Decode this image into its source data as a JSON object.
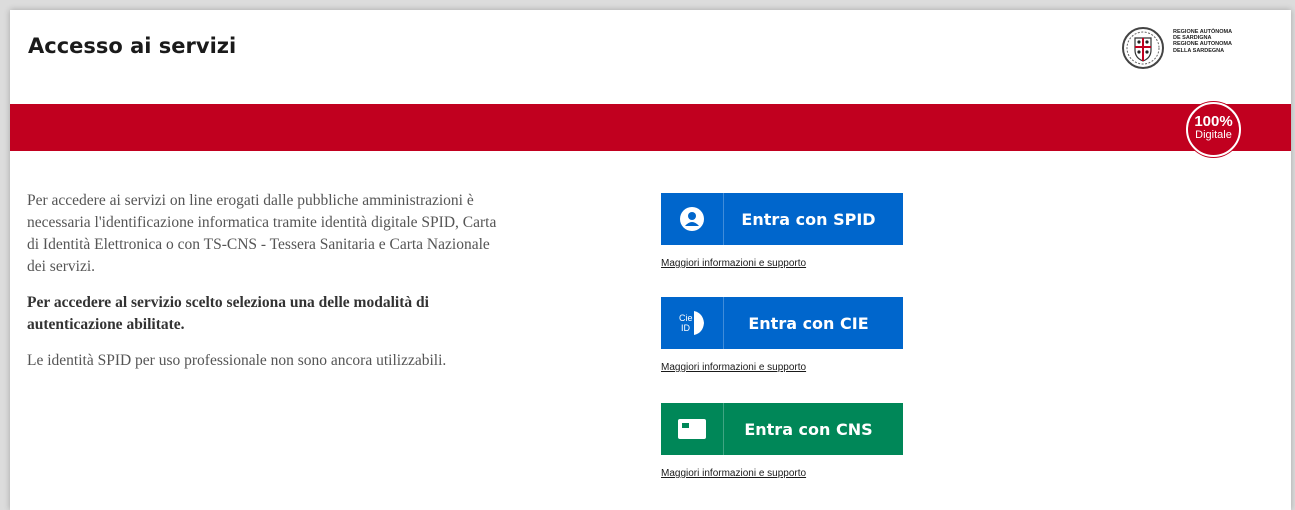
{
  "header": {
    "title": "Accesso ai servizi",
    "region_lines": [
      "REGIONE AUTÒNOMA",
      "DE SARDIGNA",
      "REGIONE AUTONOMA",
      "DELLA SARDEGNA"
    ]
  },
  "badge": {
    "percent": "100%",
    "label": "Digitale"
  },
  "intro": {
    "paragraph1": "Per accedere ai servizi on line erogati dalle pubbliche amministrazioni è necessaria l'identificazione informatica tramite identità digitale SPID, Carta di Identità Elettronica o con TS-CNS - Tessera Sanitaria e Carta Nazionale dei servizi.",
    "paragraph2": "Per accedere al servizio scelto seleziona una delle modalità di autenticazione abilitate.",
    "paragraph3": "Le identità SPID per uso professionale non sono ancora utilizzabili."
  },
  "login": {
    "spid_label": "Entra con SPID",
    "cie_label": "Entra con CIE",
    "cns_label": "Entra con CNS",
    "cie_icon_text_top": "Cie",
    "cie_icon_text_bottom": "ID",
    "more_info": "Maggiori informazioni e supporto"
  },
  "colors": {
    "brand_red": "#c1001f",
    "button_blue": "#0066cc",
    "button_green": "#008758"
  },
  "icons": {
    "spid": "user-circle-icon",
    "cie": "cie-id-icon",
    "cns": "card-icon"
  }
}
